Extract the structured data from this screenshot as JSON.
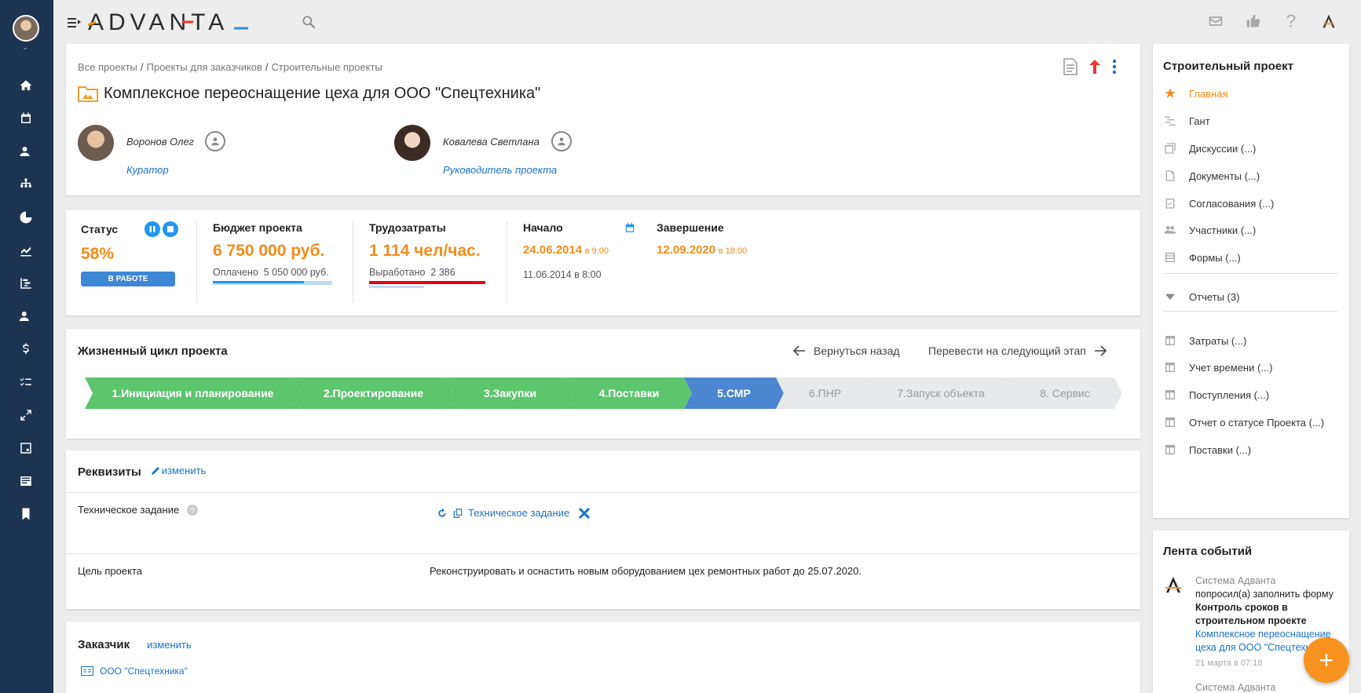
{
  "app": {
    "logo": "ADVANTA",
    "accent": "#f28c1a",
    "rail_bg": "#1b3452",
    "link_color": "#1a73c6"
  },
  "header": {
    "icons": [
      "menu-toggle-icon",
      "search-icon",
      "mail-icon",
      "thumbs-up-icon",
      "help-icon",
      "advanta-user-icon"
    ]
  },
  "rail": {
    "icons": [
      "home-icon",
      "calendar-icon",
      "contacts-icon",
      "org-structure-icon",
      "pie-chart-icon",
      "analytics-icon",
      "gantt-icon",
      "team-icon",
      "dollar-icon",
      "checklist-icon",
      "expand-icon",
      "dashboard-icon",
      "news-icon",
      "bookmark-icon"
    ]
  },
  "project": {
    "breadcrumb": [
      "Все проекты",
      "Проекты для заказчиков",
      "Строительные проекты"
    ],
    "title": "Комплексное переоснащение цеха для ООО \"Спецтехника\"",
    "curator": {
      "name": "Воронов Олег",
      "role": "Куратор"
    },
    "manager": {
      "name": "Ковалева Светлана",
      "role": "Руководитель проекта"
    }
  },
  "stats": {
    "status": {
      "label": "Статус",
      "value": "58%",
      "badge": "В РАБОТЕ"
    },
    "budget": {
      "label": "Бюджет проекта",
      "value": "6 750 000 руб.",
      "sub_label": "Оплачено",
      "sub_value": "5 050 000 руб.",
      "progress": 0.76
    },
    "labor": {
      "label": "Трудозатраты",
      "value": "1 114 чел/час.",
      "sub_label": "Выработано",
      "sub_value": "2 386",
      "progress": 0.47
    },
    "start": {
      "label": "Начало",
      "date": "24.06.2014",
      "time": "в 9:00",
      "actual": "11.06.2014 в 8:00"
    },
    "finish": {
      "label": "Завершение",
      "date": "12.09.2020",
      "time": "в 18:00"
    }
  },
  "lifecycle": {
    "title": "Жизненный цикл проекта",
    "back": "Вернуться назад",
    "next": "Перевести на следующий этап",
    "stages": [
      {
        "label": "1.Инициация и планирование",
        "state": "done"
      },
      {
        "label": "2.Проектирование",
        "state": "done"
      },
      {
        "label": "3.Закупки",
        "state": "done"
      },
      {
        "label": "4.Поставки",
        "state": "done"
      },
      {
        "label": "5.СМР",
        "state": "current"
      },
      {
        "label": "6.ПНР",
        "state": "todo"
      },
      {
        "label": "7.Запуск объекта",
        "state": "todo"
      },
      {
        "label": "8. Сервис",
        "state": "todo"
      }
    ]
  },
  "requisites": {
    "title": "Реквизиты",
    "edit": "изменить",
    "tech_label": "Техническое задание",
    "tech_link": "Техническое задание",
    "goal_label": "Цель проекта",
    "goal_value": "Реконструировать и оснастить новым оборудованием цех ремонтных работ до 25.07.2020."
  },
  "customer": {
    "title": "Заказчик",
    "edit": "изменить",
    "company": "ООО \"Спецтехника\""
  },
  "right_panel": {
    "title": "Строительный проект",
    "items": [
      {
        "label": "Главная",
        "icon": "star-icon"
      },
      {
        "label": "Гант",
        "icon": "gantt-icon"
      },
      {
        "label": "Дискуссии (...)",
        "icon": "discussions-icon"
      },
      {
        "label": "Документы (...)",
        "icon": "documents-icon"
      },
      {
        "label": "Согласования (...)",
        "icon": "approvals-icon"
      },
      {
        "label": "Участники (...)",
        "icon": "participants-icon"
      },
      {
        "label": "Формы (...)",
        "icon": "forms-icon"
      }
    ],
    "reports": "Отчеты (3)",
    "report_items": [
      "Затраты (...)",
      "Учет времени (...)",
      "Поступления (...)",
      "Отчет о статусе Проекта (...)",
      "Поставки (...)"
    ]
  },
  "feed": {
    "title": "Лента событий",
    "author": "Система Адванта",
    "text1": "попросил(а) заполнить форму ",
    "form": "Контроль сроков в строительном проекте",
    "link": "Комплексное переоснащение цеха для ООО \"Спецтехника\"",
    "time": "21 марта в 07:18",
    "author2": "Система Адванта"
  }
}
